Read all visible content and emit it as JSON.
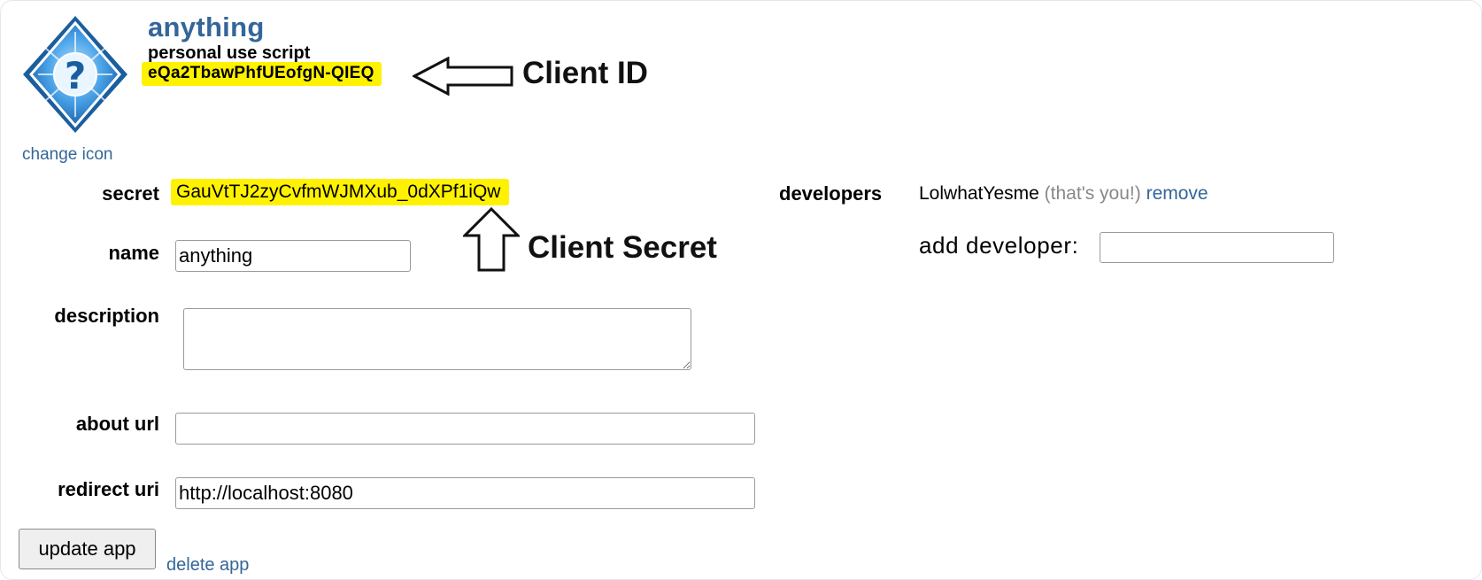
{
  "app": {
    "name": "anything",
    "type": "personal use script",
    "client_id": "eQa2TbawPhfUEofgN-QIEQ",
    "change_icon_label": "change icon",
    "icon": "question-mark-diamond-icon"
  },
  "annotations": {
    "client_id_label": "Client ID",
    "client_secret_label": "Client Secret",
    "highlight_color": "#fff200"
  },
  "form": {
    "secret_label": "secret",
    "secret_value": "GauVtTJ2zyCvfmWJMXub_0dXPf1iQw",
    "name_label": "name",
    "name_value": "anything",
    "description_label": "description",
    "description_value": "",
    "about_url_label": "about url",
    "about_url_value": "",
    "redirect_uri_label": "redirect uri",
    "redirect_uri_value": "http://localhost:8080",
    "update_button": "update app",
    "delete_link": "delete app"
  },
  "developers": {
    "label": "developers",
    "name": "LolwhatYesme",
    "you_note": "(that's you!)",
    "remove_link": "remove",
    "add_label": "add developer:",
    "add_value": ""
  },
  "colors": {
    "link": "#336699",
    "title": "#336699",
    "icon_blue": "#2a7fc8"
  }
}
